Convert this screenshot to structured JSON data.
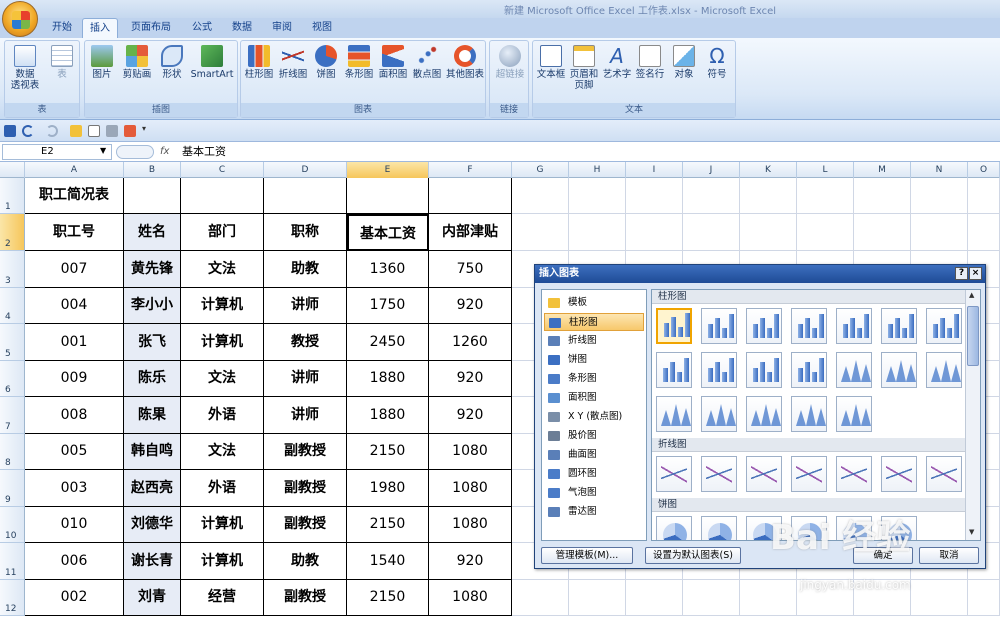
{
  "window": {
    "title": "新建 Microsoft Office Excel 工作表.xlsx - Microsoft Excel"
  },
  "tabs": [
    "开始",
    "插入",
    "页面布局",
    "公式",
    "数据",
    "审阅",
    "视图"
  ],
  "active_tab": "插入",
  "ribbon": {
    "groups": [
      {
        "label": "表",
        "buttons": [
          "数据\n透视表",
          "表"
        ]
      },
      {
        "label": "插图",
        "buttons": [
          "图片",
          "剪贴画",
          "形状",
          "SmartArt"
        ]
      },
      {
        "label": "图表",
        "buttons": [
          "柱形图",
          "折线图",
          "饼图",
          "条形图",
          "面积图",
          "散点图",
          "其他图表"
        ]
      },
      {
        "label": "链接",
        "buttons": [
          "超链接"
        ]
      },
      {
        "label": "文本",
        "buttons": [
          "文本框",
          "页眉和\n页脚",
          "艺术字",
          "签名行",
          "对象",
          "符号"
        ]
      }
    ]
  },
  "formula_bar": {
    "name_box": "E2",
    "fx": "fx",
    "value": "基本工资"
  },
  "columns": [
    "A",
    "B",
    "C",
    "D",
    "E",
    "F",
    "G",
    "H",
    "I",
    "J",
    "K",
    "L",
    "M",
    "N",
    "O"
  ],
  "rows": [
    "1",
    "2",
    "3",
    "4",
    "5",
    "6",
    "7",
    "8",
    "9",
    "10",
    "11",
    "12"
  ],
  "sheet": {
    "title": "职工简况表",
    "headers": [
      "职工号",
      "姓名",
      "部门",
      "职称",
      "基本工资",
      "内部津贴"
    ],
    "records": [
      [
        "007",
        "黄先锋",
        "文法",
        "助教",
        "1360",
        "750"
      ],
      [
        "004",
        "李小小",
        "计算机",
        "讲师",
        "1750",
        "920"
      ],
      [
        "001",
        "张飞",
        "计算机",
        "教授",
        "2450",
        "1260"
      ],
      [
        "009",
        "陈乐",
        "文法",
        "讲师",
        "1880",
        "920"
      ],
      [
        "008",
        "陈果",
        "外语",
        "讲师",
        "1880",
        "920"
      ],
      [
        "005",
        "韩自鸣",
        "文法",
        "副教授",
        "2150",
        "1080"
      ],
      [
        "003",
        "赵西亮",
        "外语",
        "副教授",
        "1980",
        "1080"
      ],
      [
        "010",
        "刘德华",
        "计算机",
        "副教授",
        "2150",
        "1080"
      ],
      [
        "006",
        "谢长青",
        "计算机",
        "助教",
        "1540",
        "920"
      ],
      [
        "002",
        "刘青",
        "经营",
        "副教授",
        "2150",
        "1080"
      ]
    ]
  },
  "dialog": {
    "title": "插入图表",
    "help": "?",
    "close": "×",
    "categories": [
      "模板",
      "柱形图",
      "折线图",
      "饼图",
      "条形图",
      "面积图",
      "X Y (散点图)",
      "股价图",
      "曲面图",
      "圆环图",
      "气泡图",
      "雷达图"
    ],
    "active_category": "柱形图",
    "sections": [
      "柱形图",
      "折线图",
      "饼图"
    ],
    "manage_button": "管理模板(M)...",
    "default_button": "设置为默认图表(S)",
    "ok_button": "确定",
    "cancel_button": "取消"
  },
  "watermark": {
    "text": "Bai 经验",
    "url": "jingyan.baidu.com"
  },
  "colors": {
    "accent": "#15428b",
    "selected_header": "#f6c65b",
    "dialog_title": "#1e4b96"
  }
}
